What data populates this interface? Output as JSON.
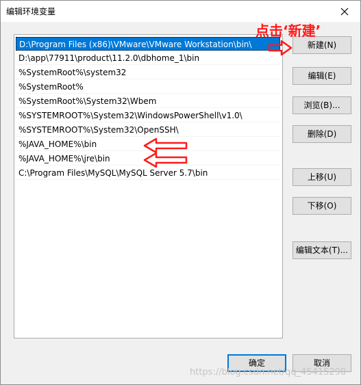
{
  "window": {
    "title": "编辑环境变量"
  },
  "path_list": {
    "items": [
      "D:\\Program Files (x86)\\VMware\\VMware Workstation\\bin\\",
      "D:\\app\\77911\\product\\11.2.0\\dbhome_1\\bin",
      "%SystemRoot%\\system32",
      "%SystemRoot%",
      "%SystemRoot%\\System32\\Wbem",
      "%SYSTEMROOT%\\System32\\WindowsPowerShell\\v1.0\\",
      "%SYSTEMROOT%\\System32\\OpenSSH\\",
      "%JAVA_HOME%\\bin",
      "%JAVA_HOME%\\jre\\bin",
      "C:\\Program Files\\MySQL\\MySQL Server 5.7\\bin"
    ],
    "selected_index": 0
  },
  "buttons": {
    "new": "新建(N)",
    "edit": "编辑(E)",
    "browse": "浏览(B)...",
    "delete": "删除(D)",
    "move_up": "上移(U)",
    "move_down": "下移(O)",
    "edit_text": "编辑文本(T)...",
    "ok": "确定",
    "cancel": "取消"
  },
  "annotation": {
    "text": "点击‘新建’",
    "color": "#ff1a1a"
  },
  "watermark": "https://blog.csdn.net/qq_45415290",
  "colors": {
    "selection": "#0078d7",
    "annotation": "#ff1a1a"
  }
}
